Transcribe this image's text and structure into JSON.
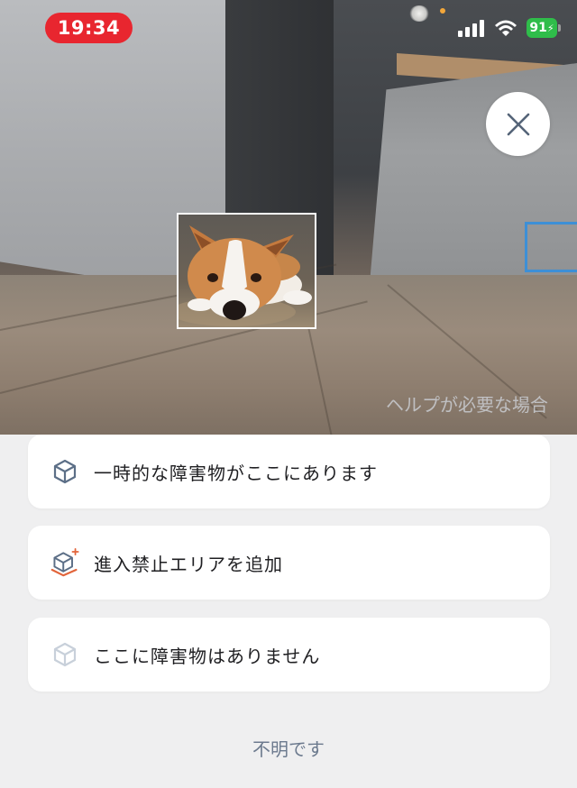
{
  "status_bar": {
    "time": "19:34",
    "battery": "91",
    "signal_icon": "cellular-signal-icon",
    "wifi_icon": "wifi-icon",
    "battery_icon": "battery-charging-icon"
  },
  "camera": {
    "close_icon": "close-icon",
    "help_link": "ヘルプが必要な場合"
  },
  "options": [
    {
      "label": "一時的な障害物がここにあります",
      "icon": "box-icon"
    },
    {
      "label": "進入禁止エリアを追加",
      "icon": "no-go-zone-box-icon"
    },
    {
      "label": "ここに障害物はありません",
      "icon": "box-faded-icon"
    }
  ],
  "unknown_link": "不明です",
  "colors": {
    "time_pill": "#e8262f",
    "battery": "#2fbd4a",
    "accent_orange": "#e2643a",
    "icon_slate": "#5c6f87",
    "link": "#6c7a8e"
  }
}
